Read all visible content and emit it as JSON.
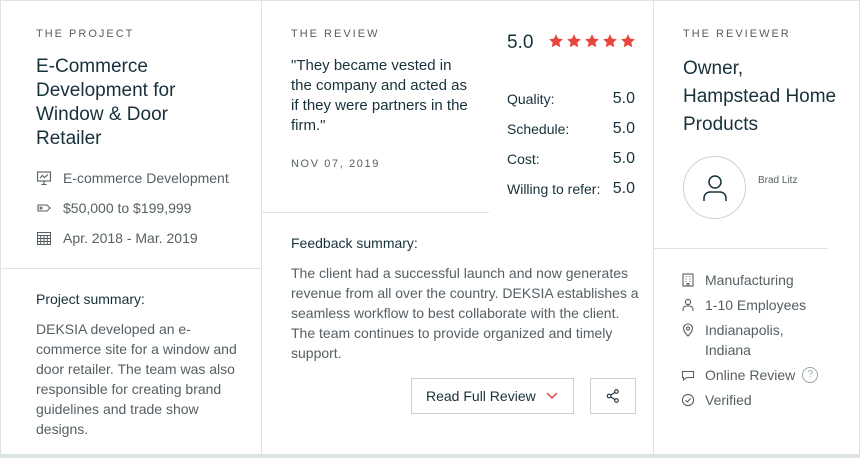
{
  "project": {
    "eyebrow": "THE PROJECT",
    "title": "E-Commerce Development for Window & Door Retailer",
    "service": "E-commerce Development",
    "budget": "$50,000 to $199,999",
    "dates": "Apr. 2018 - Mar. 2019",
    "summary_label": "Project summary:",
    "summary": "DEKSIA developed an e-commerce site for a window and door retailer. The team was also responsible for creating brand guidelines and trade show designs."
  },
  "review": {
    "eyebrow": "THE REVIEW",
    "quote": "\"They became vested in the company and acted as if they were partners in the firm.\"",
    "date": "NOV 07, 2019",
    "overall": "5.0",
    "star_count": 5,
    "star_color": "#e8453c",
    "ratings": [
      {
        "label": "Quality:",
        "value": "5.0"
      },
      {
        "label": "Schedule:",
        "value": "5.0"
      },
      {
        "label": "Cost:",
        "value": "5.0"
      },
      {
        "label": "Willing to refer:",
        "value": "5.0"
      }
    ],
    "feedback_label": "Feedback summary:",
    "feedback": "The client had a successful launch and now generates revenue from all over the country. DEKSIA establishes a seamless workflow to best collaborate with the client. The team continues to provide organized and timely support.",
    "read_full_label": "Read Full Review",
    "accent_color": "#e8453c"
  },
  "reviewer": {
    "eyebrow": "THE REVIEWER",
    "title": "Owner, Hampstead Home Products",
    "name": "Brad Litz",
    "industry": "Manufacturing",
    "employees": "1-10 Employees",
    "location": "Indianapolis, Indiana",
    "review_type": "Online Review",
    "verified": "Verified",
    "help_glyph": "?"
  }
}
